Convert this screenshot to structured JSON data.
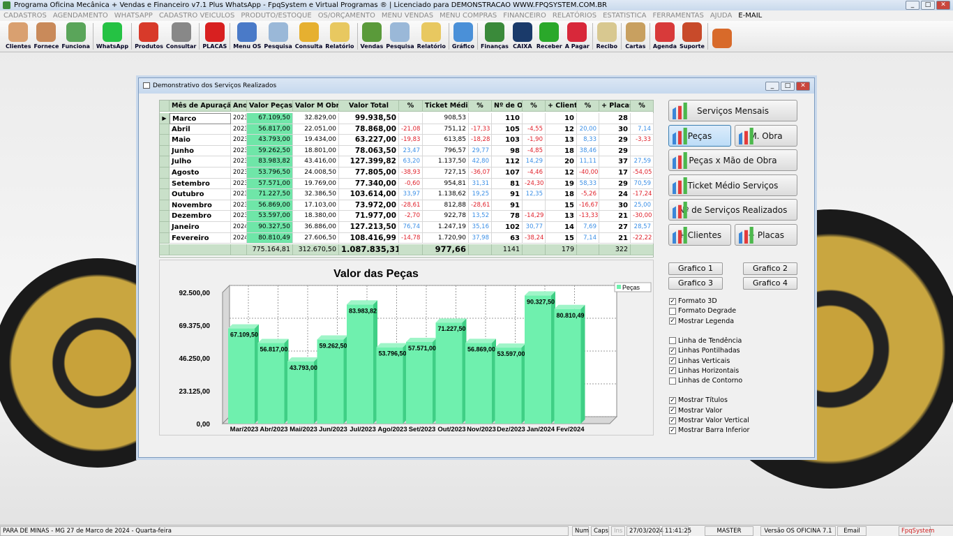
{
  "app": {
    "title": "Programa Oficina Mecânica + Vendas e Financeiro v7.1 Plus WhatsApp - FpqSystem e Virtual Programas ® | Licenciado para  DEMONSTRACAO WWW.FPQSYSTEM.COM.BR"
  },
  "menu": [
    "CADASTROS",
    "AGENDAMENTO",
    "WHATSAPP",
    "CADASTRO VEICULOS",
    "PRODUTO/ESTOQUE",
    "OS/ORÇAMENTO",
    "MENU VENDAS",
    "MENU COMPRAS",
    "FINANCEIRO",
    "RELATÓRIOS",
    "ESTATISTICA",
    "FERRAMENTAS",
    "AJUDA"
  ],
  "menu_email": "E-MAIL",
  "toolbar": [
    {
      "label": "Clientes",
      "color": "#d9a070"
    },
    {
      "label": "Fornece",
      "color": "#c98a5a"
    },
    {
      "label": "Funciona",
      "color": "#5aa55a"
    },
    "|",
    {
      "label": "WhatsApp",
      "color": "#25c244"
    },
    "|",
    {
      "label": "Produtos",
      "color": "#d83a2a"
    },
    {
      "label": "Consultar",
      "color": "#888888"
    },
    "|",
    {
      "label": "PLACAS",
      "color": "#d82020"
    },
    "|",
    {
      "label": "Menu OS",
      "color": "#4a7ac8"
    },
    {
      "label": "Pesquisa",
      "color": "#9ab8d8"
    },
    {
      "label": "Consulta",
      "color": "#e6b030"
    },
    {
      "label": "Relatório",
      "color": "#e8c860"
    },
    "|",
    {
      "label": "Vendas",
      "color": "#5a9a3a"
    },
    {
      "label": "Pesquisa",
      "color": "#9ab8d8"
    },
    {
      "label": "Relatório",
      "color": "#e8c860"
    },
    "|",
    {
      "label": "Gráfico",
      "color": "#4a90d8"
    },
    "|",
    {
      "label": "Finanças",
      "color": "#3a8a3a"
    },
    {
      "label": "CAIXA",
      "color": "#1a3a6a"
    },
    {
      "label": "Receber",
      "color": "#2aa82a"
    },
    {
      "label": "A Pagar",
      "color": "#d8283a"
    },
    "|",
    {
      "label": "Recibo",
      "color": "#d8c890"
    },
    "|",
    {
      "label": "Cartas",
      "color": "#c8a060"
    },
    "|",
    {
      "label": "Agenda",
      "color": "#d83a3a"
    },
    {
      "label": "Suporte",
      "color": "#c84a2a"
    },
    "|",
    {
      "label": "",
      "color": "#d86a2a"
    }
  ],
  "window": {
    "title": "Demonstrativo dos Serviços Realizados"
  },
  "table": {
    "headers": [
      "Mês de Apuração",
      "Ano",
      "Valor Peças",
      "Valor M Obra",
      "Valor Total",
      "%",
      "Ticket Médio",
      "%",
      "Nº de OS",
      "%",
      "+ Clientes",
      "%",
      "+ Placas",
      "%"
    ],
    "rows": [
      [
        "Marco",
        "2023",
        "67.109,50",
        "32.829,00",
        "99.938,50",
        "",
        "908,53",
        "",
        "110",
        "",
        "10",
        "",
        "28",
        ""
      ],
      [
        "Abril",
        "2023",
        "56.817,00",
        "22.051,00",
        "78.868,00",
        "-21,08",
        "751,12",
        "-17,33",
        "105",
        "-4,55",
        "12",
        "20,00",
        "30",
        "7,14"
      ],
      [
        "Maio",
        "2023",
        "43.793,00",
        "19.434,00",
        "63.227,00",
        "-19,83",
        "613,85",
        "-18,28",
        "103",
        "-1,90",
        "13",
        "8,33",
        "29",
        "-3,33"
      ],
      [
        "Junho",
        "2023",
        "59.262,50",
        "18.801,00",
        "78.063,50",
        "23,47",
        "796,57",
        "29,77",
        "98",
        "-4,85",
        "18",
        "38,46",
        "29",
        ""
      ],
      [
        "Julho",
        "2023",
        "83.983,82",
        "43.416,00",
        "127.399,82",
        "63,20",
        "1.137,50",
        "42,80",
        "112",
        "14,29",
        "20",
        "11,11",
        "37",
        "27,59"
      ],
      [
        "Agosto",
        "2023",
        "53.796,50",
        "24.008,50",
        "77.805,00",
        "-38,93",
        "727,15",
        "-36,07",
        "107",
        "-4,46",
        "12",
        "-40,00",
        "17",
        "-54,05"
      ],
      [
        "Setembro",
        "2023",
        "57.571,00",
        "19.769,00",
        "77.340,00",
        "-0,60",
        "954,81",
        "31,31",
        "81",
        "-24,30",
        "19",
        "58,33",
        "29",
        "70,59"
      ],
      [
        "Outubro",
        "2023",
        "71.227,50",
        "32.386,50",
        "103.614,00",
        "33,97",
        "1.138,62",
        "19,25",
        "91",
        "12,35",
        "18",
        "-5,26",
        "24",
        "-17,24"
      ],
      [
        "Novembro",
        "2023",
        "56.869,00",
        "17.103,00",
        "73.972,00",
        "-28,61",
        "812,88",
        "-28,61",
        "91",
        "",
        "15",
        "-16,67",
        "30",
        "25,00"
      ],
      [
        "Dezembro",
        "2023",
        "53.597,00",
        "18.380,00",
        "71.977,00",
        "-2,70",
        "922,78",
        "13,52",
        "78",
        "-14,29",
        "13",
        "-13,33",
        "21",
        "-30,00"
      ],
      [
        "Janeiro",
        "2024",
        "90.327,50",
        "36.886,00",
        "127.213,50",
        "76,74",
        "1.247,19",
        "35,16",
        "102",
        "30,77",
        "14",
        "7,69",
        "27",
        "28,57"
      ],
      [
        "Fevereiro",
        "2024",
        "80.810,49",
        "27.606,50",
        "108.416,99",
        "-14,78",
        "1.720,90",
        "37,98",
        "63",
        "-38,24",
        "15",
        "7,14",
        "21",
        "-22,22"
      ]
    ],
    "totals": [
      "",
      "",
      "775.164,81",
      "312.670,50",
      "1.087.835,31",
      "",
      "977,66",
      "",
      "1141",
      "",
      "179",
      "",
      "322",
      ""
    ]
  },
  "chart_data": {
    "type": "bar",
    "title": "Valor das Peças",
    "categories": [
      "Mar/2023",
      "Abr/2023",
      "Mai/2023",
      "Jun/2023",
      "Jul/2023",
      "Ago/2023",
      "Set/2023",
      "Out/2023",
      "Nov/2023",
      "Dez/2023",
      "Jan/2024",
      "Fev/2024"
    ],
    "series": [
      {
        "name": "Peças",
        "values": [
          67109.5,
          56817,
          43793,
          59262.5,
          83983.82,
          53796.5,
          57571,
          71227.5,
          56869,
          53597,
          90327.5,
          80810.49
        ],
        "labels": [
          "67.109,50",
          "56.817,00",
          "43.793,00",
          "59.262,50",
          "83.983,82",
          "53.796,50",
          "57.571,00",
          "71.227,50",
          "56.869,00",
          "53.597,00",
          "90.327,50",
          "80.810,49"
        ]
      }
    ],
    "yticks": [
      "0,00",
      "23.125,00",
      "46.250,00",
      "69.375,00",
      "92.500,00"
    ],
    "ylim": [
      0,
      92500
    ],
    "legend": "top-right",
    "bar_color": "#6ff0ae"
  },
  "side": {
    "servicos_mensais": "Serviços Mensais",
    "pecas": "Peças",
    "mobra": "M. Obra",
    "pecas_mao": "Peças x Mão de Obra",
    "ticket": "Ticket Médio Serviços",
    "num_servicos": "Nº de Serviços Realizados",
    "clientes": "+ Clientes",
    "placas": "+ Placas",
    "graficos": [
      "Grafico 1",
      "Grafico 2",
      "Grafico 3",
      "Grafico 4"
    ],
    "options": [
      {
        "label": "Formato 3D",
        "checked": true
      },
      {
        "label": "Formato Degrade",
        "checked": false
      },
      {
        "label": "Mostrar Legenda",
        "checked": true
      },
      null,
      {
        "label": "Linha de Tendência",
        "checked": false
      },
      {
        "label": "Linhas Pontilhadas",
        "checked": true
      },
      {
        "label": "Linhas Verticais",
        "checked": true
      },
      {
        "label": "Linhas Horizontais",
        "checked": true
      },
      {
        "label": "Linhas de Contorno",
        "checked": false
      },
      null,
      {
        "label": "Mostrar Títulos",
        "checked": true
      },
      {
        "label": "Mostrar Valor",
        "checked": true
      },
      {
        "label": "Mostrar Valor Vertical",
        "checked": true
      },
      {
        "label": "Mostrar Barra Inferior",
        "checked": true
      }
    ]
  },
  "status": {
    "location": "PARA DE MINAS - MG 27 de Marco de 2024 - Quarta-feira",
    "num": "Num",
    "caps": "Caps",
    "ins": "Ins",
    "date": "27/03/2024",
    "time": "11:41:25",
    "user": "MASTER",
    "version": "Versão OS OFICINA 7.1",
    "email": "Email",
    "brand": "FpqSystem"
  }
}
